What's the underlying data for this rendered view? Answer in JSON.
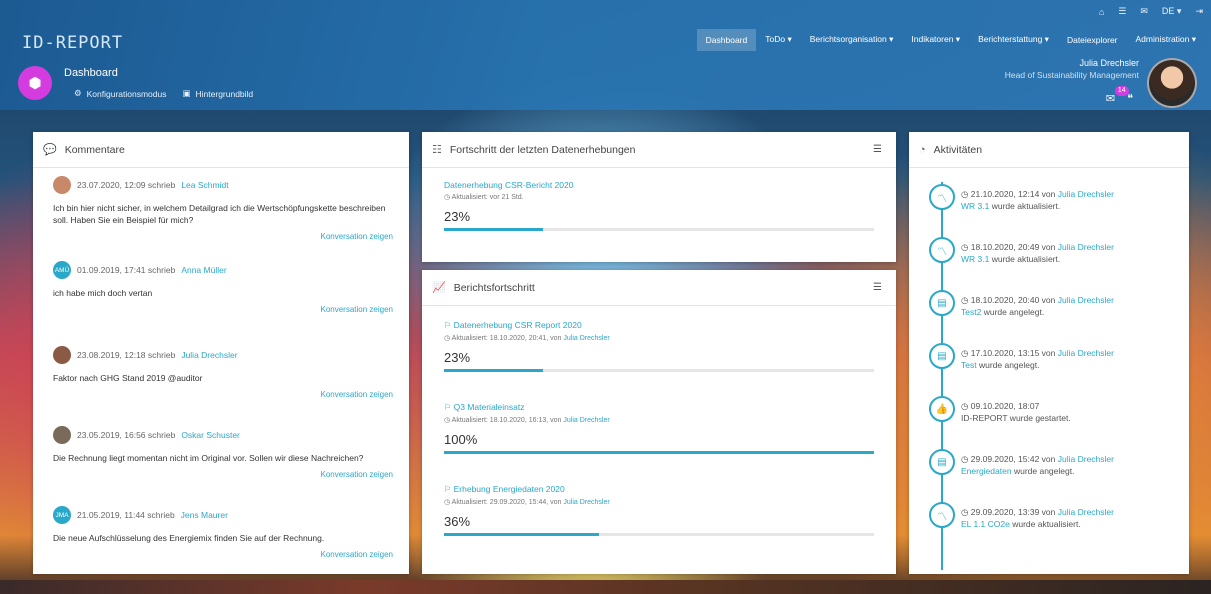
{
  "topbar": {
    "home_icon": "home-icon",
    "list_icon": "list-icon",
    "mail_icon": "mail-icon",
    "language": "DE",
    "logout_icon": "logout-icon"
  },
  "brand": {
    "logo": "ID-REPORT"
  },
  "nav": [
    {
      "label": "Dashboard",
      "active": true
    },
    {
      "label": "ToDo ▾",
      "active": false
    },
    {
      "label": "Berichtsorganisation ▾",
      "active": false
    },
    {
      "label": "Indikatoren ▾",
      "active": false
    },
    {
      "label": "Berichterstattung ▾",
      "active": false
    },
    {
      "label": "Dateiexplorer",
      "active": false
    },
    {
      "label": "Administration ▾",
      "active": false
    }
  ],
  "page": {
    "title": "Dashboard",
    "config_mode": "Konfigurationsmodus",
    "background_image": "Hintergrundbild"
  },
  "user": {
    "name": "Julia Drechsler",
    "role": "Head of Sustainability Management",
    "message_count": "14"
  },
  "comments": {
    "title": "Kommentare",
    "link_label": "Konversation zeigen",
    "items": [
      {
        "initials": "",
        "avatar_color": "#c8896a",
        "date": "23.07.2020, 12:09 schrieb",
        "author": "Lea Schmidt",
        "text": "Ich bin hier nicht sicher, in welchem Detailgrad ich die Wertschöpfungskette beschreiben soll. Haben Sie ein Beispiel für mich?"
      },
      {
        "initials": "AMÜ",
        "avatar_color": "#2aa8c9",
        "date": "01.09.2019, 17:41 schrieb",
        "author": "Anna Müller",
        "text": "ich habe mich doch vertan"
      },
      {
        "initials": "",
        "avatar_color": "#8a5a44",
        "date": "23.08.2019, 12:18 schrieb",
        "author": "Julia Drechsler",
        "text": "Faktor nach GHG Stand 2019 @auditor"
      },
      {
        "initials": "",
        "avatar_color": "#7a6a5a",
        "date": "23.05.2019, 16:56 schrieb",
        "author": "Oskar Schuster",
        "text": "Die Rechnung liegt momentan nicht im Original vor. Sollen wir diese Nachreichen?"
      },
      {
        "initials": "JMA",
        "avatar_color": "#2aa8c9",
        "date": "21.05.2019, 11:44 schrieb",
        "author": "Jens Maurer",
        "text": "Die neue Aufschlüsselung des Energiemix finden Sie auf der Rechnung."
      }
    ]
  },
  "survey_progress": {
    "title": "Fortschritt der letzten Datenerhebungen",
    "items": [
      {
        "title": "Datenerhebung CSR-Bericht 2020",
        "updated": "Aktualisiert: vor 21 Std.",
        "value_label": "23%",
        "fraction": 0.23
      }
    ]
  },
  "report_progress": {
    "title": "Berichtsfortschritt",
    "items": [
      {
        "title": "Datenerhebung CSR Report 2020",
        "updated": "Aktualisiert: 18.10.2020, 20:41, von",
        "by": "Julia Drechsler",
        "value_label": "23%",
        "fraction": 0.23
      },
      {
        "title": "Q3 Materialeinsatz",
        "updated": "Aktualisiert: 18.10.2020, 16:13, von",
        "by": "Julia Drechsler",
        "value_label": "100%",
        "fraction": 1.0
      },
      {
        "title": "Erhebung Energiedaten 2020",
        "updated": "Aktualisiert: 29.09.2020, 15:44, von",
        "by": "Julia Drechsler",
        "value_label": "36%",
        "fraction": 0.36
      }
    ]
  },
  "activities": {
    "title": "Aktivitäten",
    "items": [
      {
        "icon": "chart-icon",
        "date": "21.10.2020, 12:14 von",
        "author": "Julia Drechsler",
        "object": "WR 3.1",
        "action": "wurde aktualisiert."
      },
      {
        "icon": "chart-icon",
        "date": "18.10.2020, 20:49 von",
        "author": "Julia Drechsler",
        "object": "WR 3.1",
        "action": "wurde aktualisiert."
      },
      {
        "icon": "document-icon",
        "date": "18.10.2020, 20:40 von",
        "author": "Julia Drechsler",
        "object": "Test2",
        "action": "wurde angelegt."
      },
      {
        "icon": "document-icon",
        "date": "17.10.2020, 13:15 von",
        "author": "Julia Drechsler",
        "object": "Test",
        "action": "wurde angelegt."
      },
      {
        "icon": "thumbs-up-icon",
        "date": "09.10.2020, 18:07",
        "author": "",
        "object": "",
        "action": "ID-REPORT wurde gestartet."
      },
      {
        "icon": "document-icon",
        "date": "29.09.2020, 15:42 von",
        "author": "Julia Drechsler",
        "object": "Energiedaten",
        "action": "wurde angelegt."
      },
      {
        "icon": "chart-icon",
        "date": "29.09.2020, 13:39 von",
        "author": "Julia Drechsler",
        "object": "EL 1.1 CO2e",
        "action": "wurde aktualisiert."
      }
    ]
  }
}
